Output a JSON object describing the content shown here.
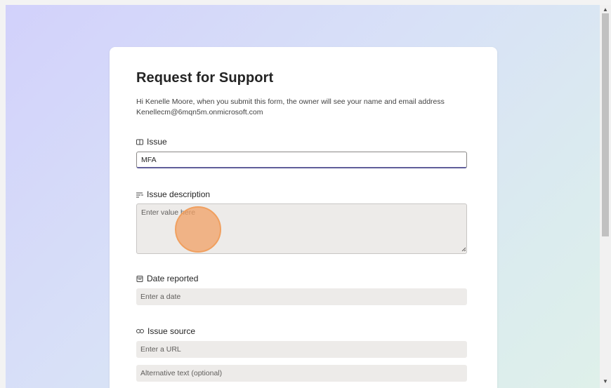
{
  "form": {
    "title": "Request for Support",
    "intro_line1": "Hi Kenelle Moore, when you submit this form, the owner will see your name and email address",
    "intro_line2": "Kenellecm@6mqn5m.onmicrosoft.com",
    "fields": {
      "issue": {
        "label": "Issue",
        "value": "MFA",
        "icon": "text-field-icon"
      },
      "issue_description": {
        "label": "Issue description",
        "placeholder": "Enter value here",
        "icon": "multiline-text-icon"
      },
      "date_reported": {
        "label": "Date reported",
        "placeholder": "Enter a date",
        "icon": "calendar-icon"
      },
      "issue_source": {
        "label": "Issue source",
        "url_placeholder": "Enter a URL",
        "alt_placeholder": "Alternative text (optional)",
        "icon": "link-icon"
      }
    }
  },
  "colors": {
    "accent_border": "#605e9a",
    "cursor_highlight": "#f0a060"
  }
}
